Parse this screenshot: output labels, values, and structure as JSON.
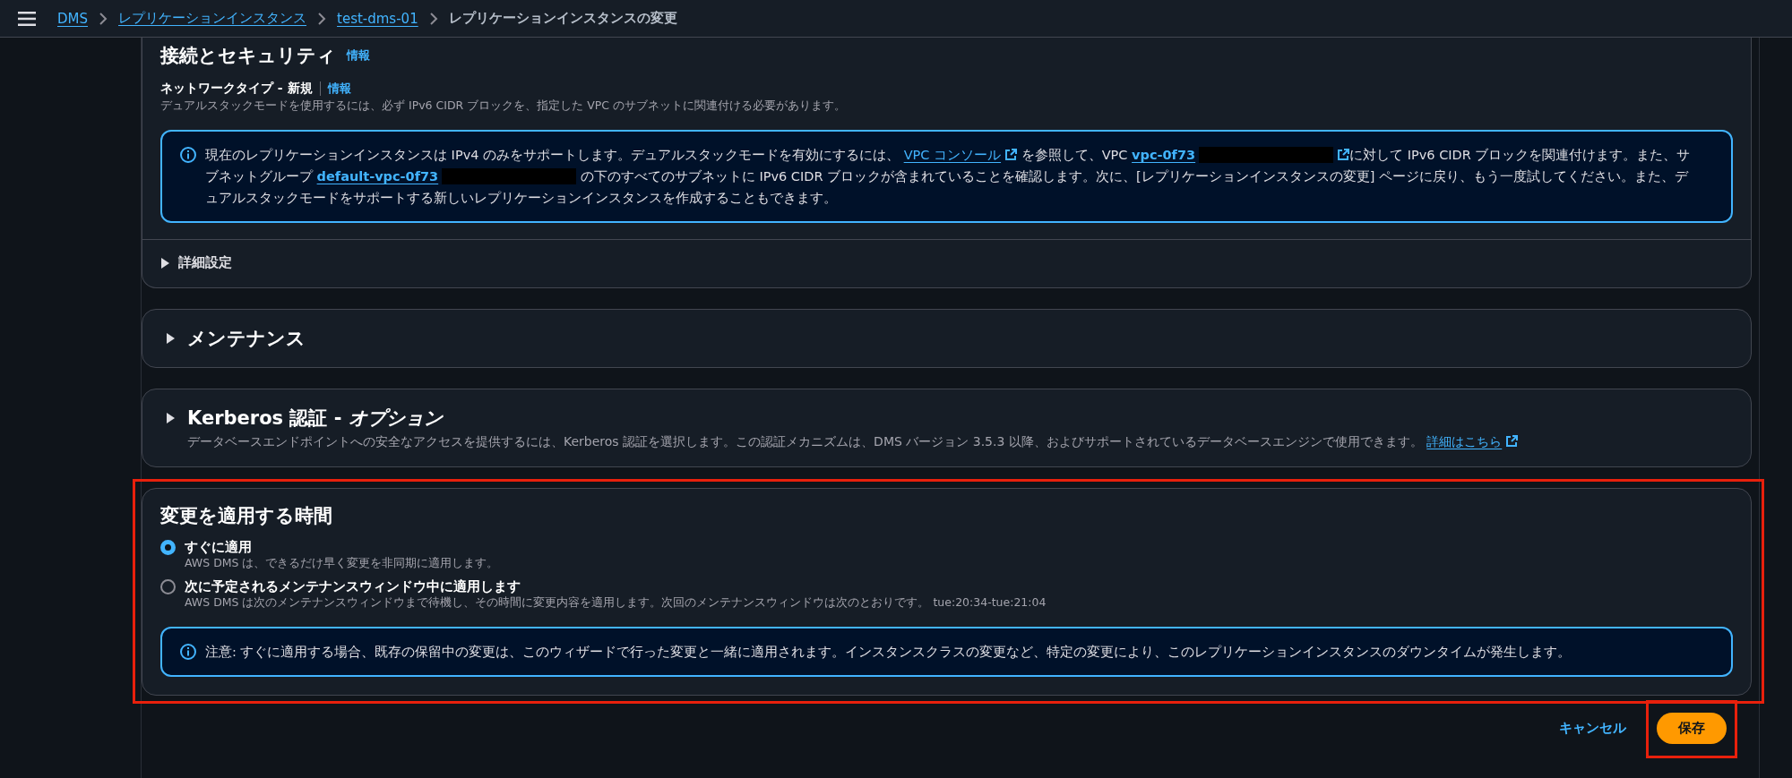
{
  "breadcrumbs": [
    {
      "label": "DMS",
      "link": true
    },
    {
      "label": "レプリケーションインスタンス",
      "link": true
    },
    {
      "label": "test-dms-01",
      "link": true
    },
    {
      "label": "レプリケーションインスタンスの変更",
      "link": false
    }
  ],
  "sections": [
    {
      "kind": "connection",
      "highlighted": false,
      "title": "接続とセキュリティ",
      "info": "情報",
      "field_label": "ネットワークタイプ - 新規",
      "field_info": "情報",
      "description": "デュアルスタックモードを使用するには、必ず IPv6 CIDR ブロックを、指定した VPC のサブネットに関連付ける必要があります。",
      "alert": {
        "segments": [
          {
            "kind": "text",
            "text": "現在のレプリケーションインスタンスは IPv4 のみをサポートします。デュアルスタックモードを有効にするには、 "
          },
          {
            "kind": "link",
            "text": "VPC コンソール",
            "external": true,
            "redacted": false
          },
          {
            "kind": "text",
            "text": " を参照して、VPC "
          },
          {
            "kind": "link",
            "text": "vpc-0f73",
            "external": true,
            "redacted": true
          },
          {
            "kind": "text",
            "text": "に対して IPv6 CIDR ブロックを関連付けます。また、サブネットグループ "
          },
          {
            "kind": "link",
            "text": "default-vpc-0f73",
            "external": false,
            "redacted": true
          },
          {
            "kind": "text",
            "text": " の下のすべてのサブネットに IPv6 CIDR ブロックが含まれていることを確認します。次に、[レプリケーションインスタンスの変更] ページに戻り、もう一度試してください。また、デュアルスタックモードをサポートする新しいレプリケーションインスタンスを作成することもできます。"
          }
        ]
      },
      "expander": {
        "label": "詳細設定",
        "expanded": false
      }
    },
    {
      "kind": "collapsible",
      "highlighted": false,
      "title": "メンテナンス",
      "expanded": false
    },
    {
      "kind": "collapsible",
      "highlighted": false,
      "title": "Kerberos 認証 - *オプション*",
      "expanded": false,
      "description": "データベースエンドポイントへの安全なアクセスを提供するには、Kerberos 認証を選択します。この認証メカニズムは、DMS バージョン 3.5.3 以降、およびサポートされているデータベースエンジンで使用できます。",
      "link": {
        "text": "詳細はこちら",
        "external": true
      }
    },
    {
      "kind": "apply",
      "highlighted": true,
      "title": "変更を適用する時間",
      "options": [
        {
          "label": "すぐに適用",
          "description": "AWS DMS は、できるだけ早く変更を非同期に適用します。",
          "selected": true
        },
        {
          "label": "次に予定されるメンテナンスウィンドウ中に適用します",
          "description": "AWS DMS は次のメンテナンスウィンドウまで待機し、その時間に変更内容を適用します。次回のメンテナンスウィンドウは次のとおりです。 tue:20:34-tue:21:04",
          "selected": false
        }
      ],
      "alert": {
        "segments": [
          {
            "kind": "text",
            "text": "注意: すぐに適用する場合、既存の保留中の変更は、このウィザードで行った変更と一緒に適用されます。インスタンスクラスの変更など、特定の変更により、このレプリケーションインスタンスのダウンタイムが発生します。"
          }
        ]
      }
    }
  ],
  "actions": {
    "cancel": "キャンセル",
    "save": "保存",
    "save_highlighted": true
  }
}
